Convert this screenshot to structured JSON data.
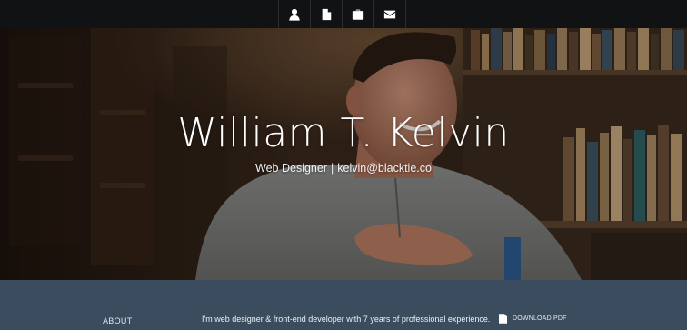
{
  "nav": {
    "icons": [
      {
        "name": "user-icon"
      },
      {
        "name": "document-icon"
      },
      {
        "name": "briefcase-icon"
      },
      {
        "name": "envelope-icon"
      }
    ]
  },
  "hero": {
    "name": "William T. Kelvin",
    "role": "Web Designer",
    "separator": "|",
    "email": "kelvin@blacktie.co"
  },
  "about": {
    "label": "ABOUT",
    "text": "I'm web designer & front-end developer with 7 years of professional experience.",
    "download_label": "DOWNLOAD PDF",
    "download_icon": "document-icon"
  },
  "colors": {
    "navbar_bg": "#111214",
    "about_bg": "#3b4c5e",
    "hero_text": "#ffffff"
  }
}
